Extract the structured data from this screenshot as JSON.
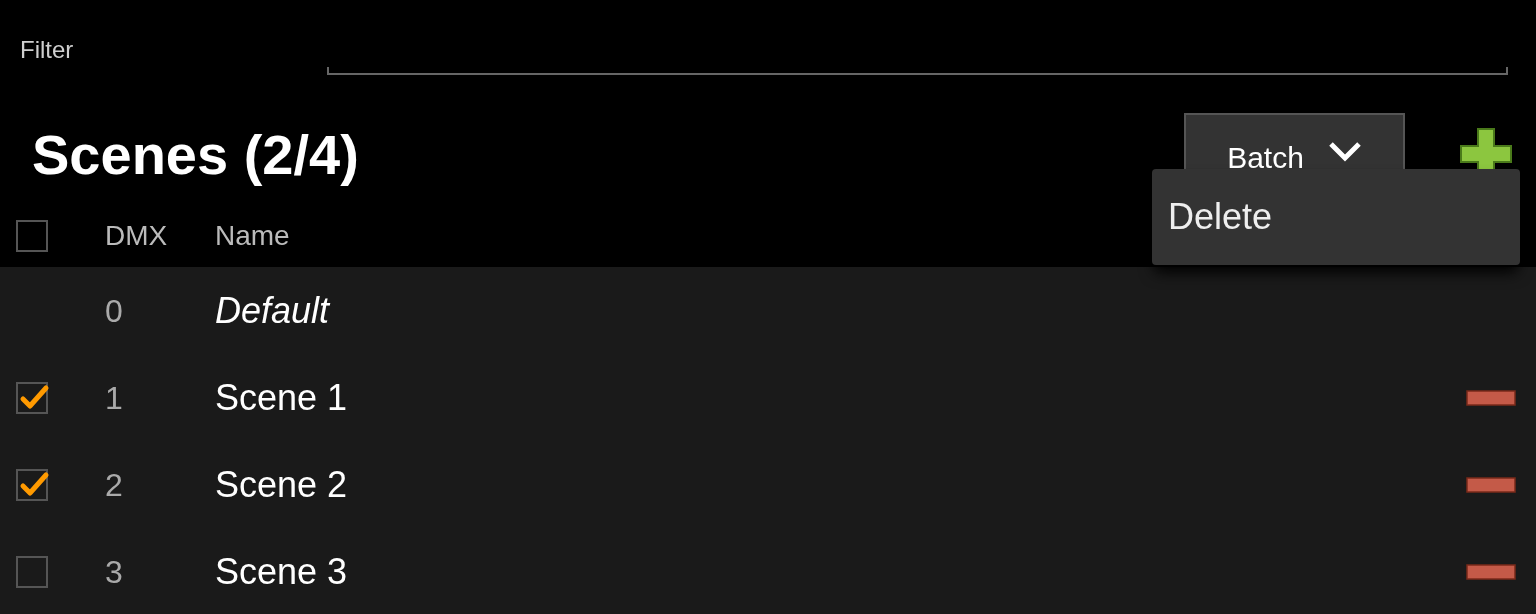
{
  "filter": {
    "label": "Filter"
  },
  "title": "Scenes (2/4)",
  "batch_button": {
    "label": "Batch"
  },
  "batch_menu": {
    "items": [
      "Delete"
    ]
  },
  "table": {
    "select_all": {
      "checked": false
    },
    "columns": [
      "DMX",
      "Name"
    ],
    "rows": [
      {
        "kind": "default",
        "dmx": "0",
        "name": "Default"
      },
      {
        "kind": "scene",
        "checked": true,
        "dmx": "1",
        "name": "Scene 1"
      },
      {
        "kind": "scene",
        "checked": true,
        "dmx": "2",
        "name": "Scene 2"
      },
      {
        "kind": "scene",
        "checked": false,
        "dmx": "3",
        "name": "Scene 3"
      }
    ]
  }
}
